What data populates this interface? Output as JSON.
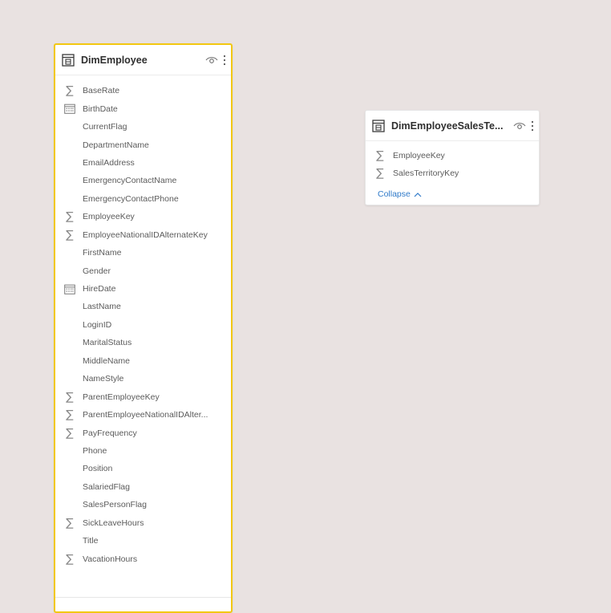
{
  "colors": {
    "canvas": "#e9e2e1",
    "selected_border": "#f2c811",
    "link": "#2f7ac9"
  },
  "tables": [
    {
      "title": "DimEmployee",
      "selected": true,
      "fields": [
        {
          "label": "BaseRate",
          "icon": "sigma-icon"
        },
        {
          "label": "BirthDate",
          "icon": "calendar-icon"
        },
        {
          "label": "CurrentFlag",
          "icon": ""
        },
        {
          "label": "DepartmentName",
          "icon": ""
        },
        {
          "label": "EmailAddress",
          "icon": ""
        },
        {
          "label": "EmergencyContactName",
          "icon": ""
        },
        {
          "label": "EmergencyContactPhone",
          "icon": ""
        },
        {
          "label": "EmployeeKey",
          "icon": "sigma-icon"
        },
        {
          "label": "EmployeeNationalIDAlternateKey",
          "icon": "sigma-icon"
        },
        {
          "label": "FirstName",
          "icon": ""
        },
        {
          "label": "Gender",
          "icon": ""
        },
        {
          "label": "HireDate",
          "icon": "calendar-icon"
        },
        {
          "label": "LastName",
          "icon": ""
        },
        {
          "label": "LoginID",
          "icon": ""
        },
        {
          "label": "MaritalStatus",
          "icon": ""
        },
        {
          "label": "MiddleName",
          "icon": ""
        },
        {
          "label": "NameStyle",
          "icon": ""
        },
        {
          "label": "ParentEmployeeKey",
          "icon": "sigma-icon"
        },
        {
          "label": "ParentEmployeeNationalIDAlter...",
          "icon": "sigma-icon"
        },
        {
          "label": "PayFrequency",
          "icon": "sigma-icon"
        },
        {
          "label": "Phone",
          "icon": ""
        },
        {
          "label": "Position",
          "icon": ""
        },
        {
          "label": "SalariedFlag",
          "icon": ""
        },
        {
          "label": "SalesPersonFlag",
          "icon": ""
        },
        {
          "label": "SickLeaveHours",
          "icon": "sigma-icon"
        },
        {
          "label": "Title",
          "icon": ""
        },
        {
          "label": "VacationHours",
          "icon": "sigma-icon"
        }
      ]
    },
    {
      "title": "DimEmployeeSalesTe...",
      "selected": false,
      "fields": [
        {
          "label": "EmployeeKey",
          "icon": "sigma-icon"
        },
        {
          "label": "SalesTerritoryKey",
          "icon": "sigma-icon"
        }
      ],
      "collapse_label": "Collapse"
    }
  ]
}
